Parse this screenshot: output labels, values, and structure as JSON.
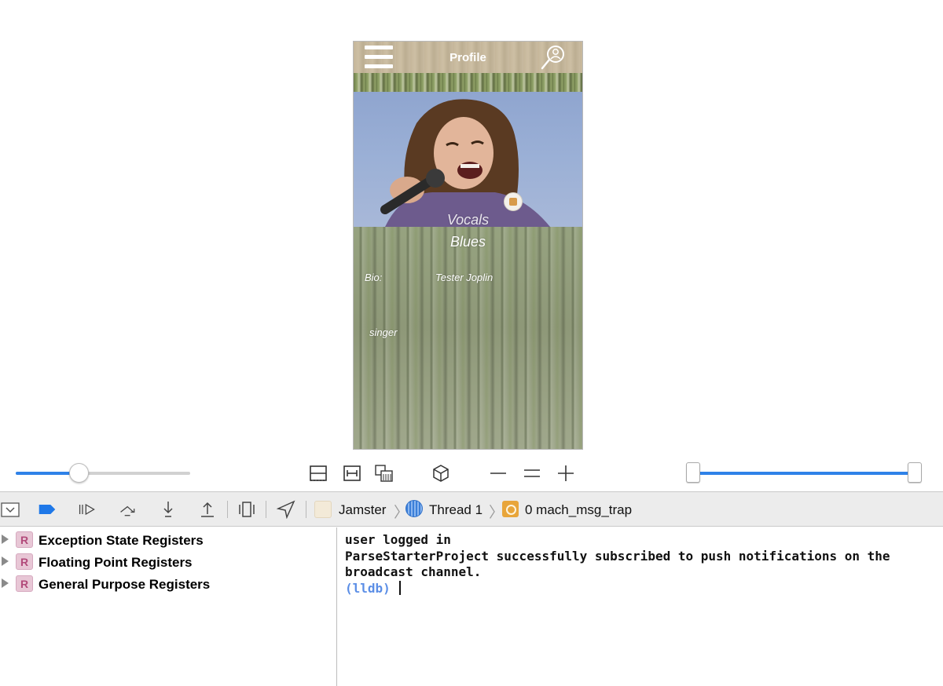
{
  "simulator": {
    "nav_title": "Profile",
    "instrument": "Vocals",
    "genre": "Blues",
    "bio_label": "Bio:",
    "name": "Tester Joplin",
    "bio": "singer"
  },
  "controls": {
    "zoom_level": 0.36,
    "range_start": 0.0,
    "range_end": 1.0,
    "icons": [
      "split-view-icon",
      "fit-width-icon",
      "memory-grid-icon",
      "3d-box-icon",
      "minus-icon",
      "equals-icon",
      "plus-icon"
    ]
  },
  "debug": {
    "breadcrumb": {
      "process": "Jamster",
      "thread": "Thread 1",
      "frame": "0 mach_msg_trap"
    },
    "toolbar_icons": [
      "hide-debug-area-icon",
      "breakpoints-toggle-icon",
      "continue-icon",
      "step-over-icon",
      "step-into-icon",
      "step-out-icon",
      "debug-view-hierarchy-icon",
      "simulate-location-icon"
    ]
  },
  "variables": {
    "items": [
      {
        "badge": "R",
        "label": "Exception State Registers"
      },
      {
        "badge": "R",
        "label": "Floating Point Registers"
      },
      {
        "badge": "R",
        "label": "General Purpose Registers"
      }
    ]
  },
  "console": {
    "lines": [
      "user logged in",
      "ParseStarterProject successfully subscribed to push notifications on the",
      "broadcast channel."
    ],
    "prompt": "(lldb)"
  },
  "colors": {
    "accent": "#2f82e8",
    "prompt": "#5b8ee6",
    "register_badge": "#e8c7d6"
  }
}
